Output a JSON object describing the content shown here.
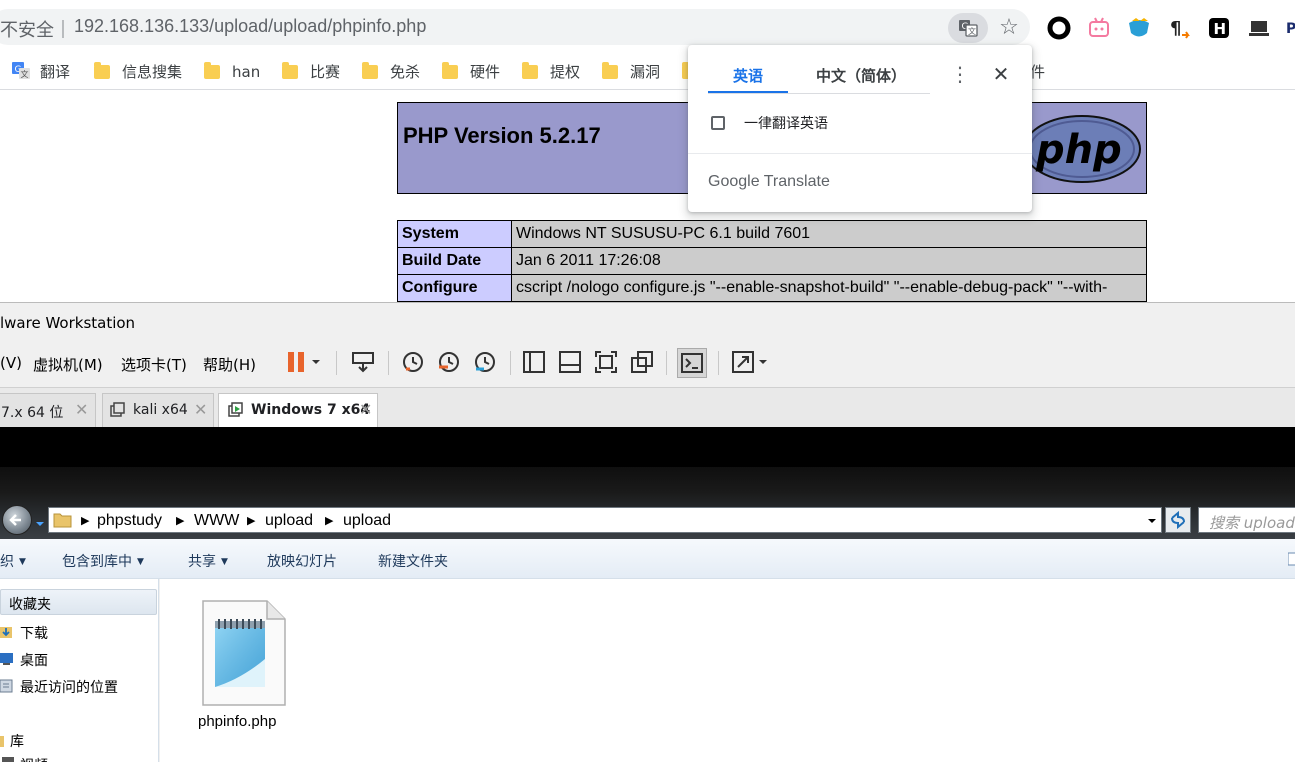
{
  "browser": {
    "security_label": "不安全｜",
    "url": "192.168.136.133/upload/upload/phpinfo.php",
    "bookmarks": [
      {
        "label": "翻译",
        "icon": "google-translate-icon"
      },
      {
        "label": "信息搜集",
        "icon": "folder-icon"
      },
      {
        "label": "han",
        "icon": "folder-icon"
      },
      {
        "label": "比赛",
        "icon": "folder-icon"
      },
      {
        "label": "免杀",
        "icon": "folder-icon"
      },
      {
        "label": "硬件",
        "icon": "folder-icon"
      },
      {
        "label": "提权",
        "icon": "folder-icon"
      },
      {
        "label": "漏洞",
        "icon": "folder-icon"
      },
      {
        "label": "件",
        "icon": "folder-icon"
      }
    ]
  },
  "phpinfo": {
    "version_title": "PHP Version 5.2.17",
    "logo_text": "php",
    "rows": [
      {
        "label": "System",
        "value": "Windows NT SUSUSU-PC 6.1 build 7601"
      },
      {
        "label": "Build Date",
        "value": "Jan 6 2011 17:26:08"
      },
      {
        "label": "Configure",
        "value": "cscript /nologo configure.js \"--enable-snapshot-build\" \"--enable-debug-pack\" \"--with-"
      }
    ]
  },
  "translate_popup": {
    "tab_source": "英语",
    "tab_target": "中文（简体）",
    "checkbox_label": "一律翻译英语",
    "brand": "Google Translate"
  },
  "vmware": {
    "title": "lware Workstation",
    "menus": [
      "(V)",
      "虚拟机(M)",
      "选项卡(T)",
      "帮助(H)"
    ],
    "tabs": [
      {
        "label": "7.x 64 位",
        "active": false
      },
      {
        "label": "kali x64",
        "active": false
      },
      {
        "label": "Windows 7 x64",
        "active": true
      }
    ]
  },
  "explorer": {
    "breadcrumb": [
      "phpstudy",
      "WWW",
      "upload",
      "upload"
    ],
    "search_placeholder": "搜索 upload",
    "commands": [
      "织",
      "包含到库中",
      "共享",
      "放映幻灯片",
      "新建文件夹"
    ],
    "nav": {
      "favorites": "收藏夹",
      "items": [
        "下载",
        "桌面",
        "最近访问的位置"
      ],
      "library": "库",
      "library_items": [
        "视频"
      ]
    },
    "files": [
      {
        "name": "phpinfo.php"
      }
    ]
  },
  "colors": {
    "php_header": "#9999cc",
    "php_label_bg": "#ccccff",
    "php_value_bg": "#cccccc",
    "translate_accent": "#1a73e8",
    "vmware_pause": "#e8642c"
  }
}
